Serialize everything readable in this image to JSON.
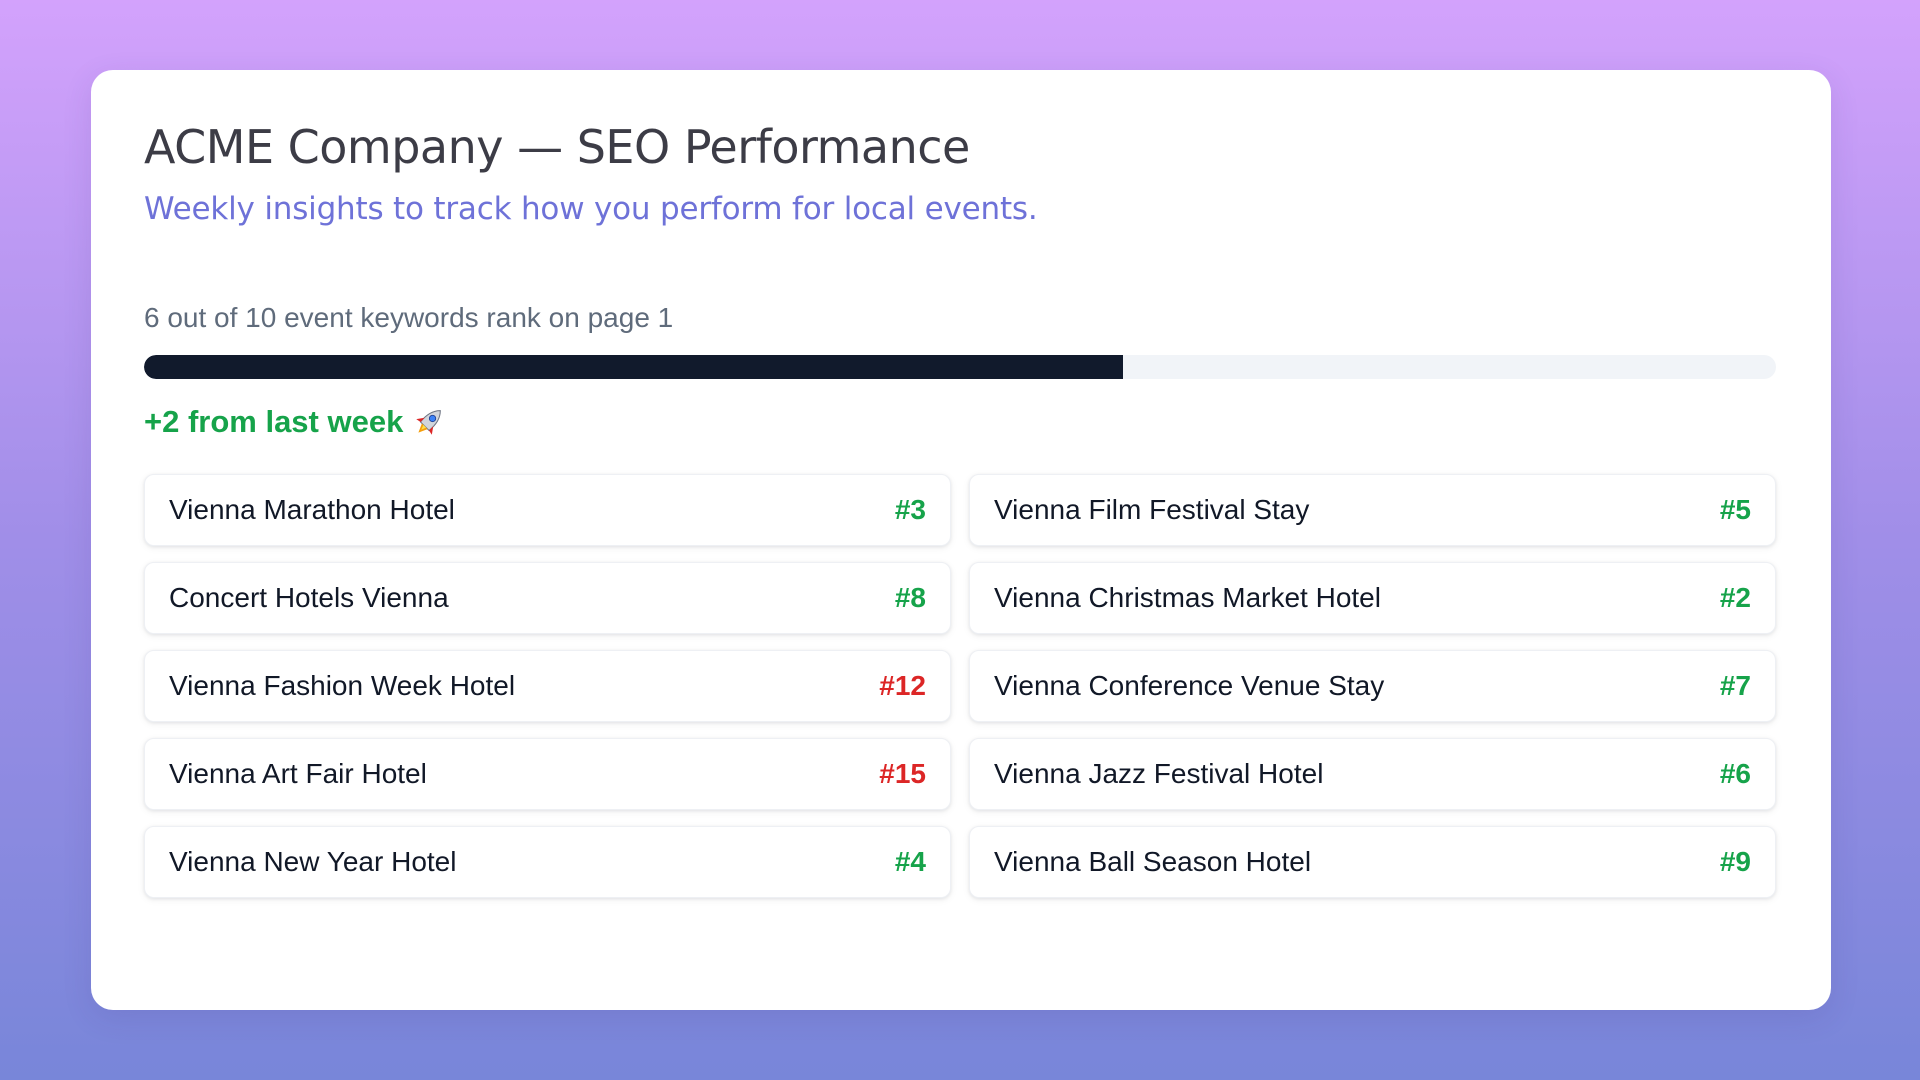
{
  "header": {
    "title": "ACME Company — SEO Performance",
    "subtitle": "Weekly insights to track how you perform for local events."
  },
  "progress": {
    "label": "6 out of 10 event keywords rank on page 1",
    "ranked": 6,
    "total": 10,
    "fraction": 0.6,
    "fill_color": "#111a2c",
    "track_color": "#f1f4f8"
  },
  "delta": {
    "text": "+2 from last week",
    "icon": "rocket-icon",
    "color": "#16a34a"
  },
  "colors": {
    "good": "#16a34a",
    "bad": "#dc2626",
    "accent": "#6e72d8"
  },
  "keywords": [
    {
      "name": "Vienna Marathon Hotel",
      "rank": "#3",
      "status": "good"
    },
    {
      "name": "Vienna Film Festival Stay",
      "rank": "#5",
      "status": "good"
    },
    {
      "name": "Concert Hotels Vienna",
      "rank": "#8",
      "status": "good"
    },
    {
      "name": "Vienna Christmas Market Hotel",
      "rank": "#2",
      "status": "good"
    },
    {
      "name": "Vienna Fashion Week Hotel",
      "rank": "#12",
      "status": "bad"
    },
    {
      "name": "Vienna Conference Venue Stay",
      "rank": "#7",
      "status": "good"
    },
    {
      "name": "Vienna Art Fair Hotel",
      "rank": "#15",
      "status": "bad"
    },
    {
      "name": "Vienna Jazz Festival Hotel",
      "rank": "#6",
      "status": "good"
    },
    {
      "name": "Vienna New Year Hotel",
      "rank": "#4",
      "status": "good"
    },
    {
      "name": "Vienna Ball Season Hotel",
      "rank": "#9",
      "status": "good"
    }
  ]
}
